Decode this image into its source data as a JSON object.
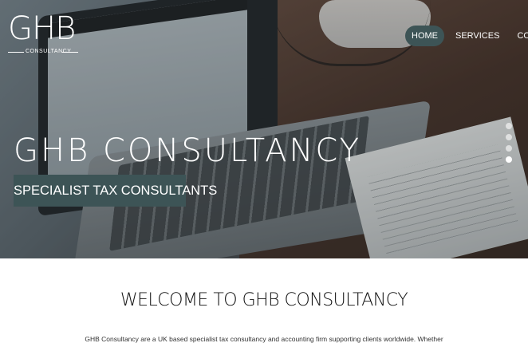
{
  "brand": {
    "logo_text": "GHB",
    "logo_sub": "CONSULTANCY"
  },
  "nav": {
    "items": [
      {
        "label": "HOME",
        "active": true
      },
      {
        "label": "SERVICES",
        "active": false
      },
      {
        "label": "CONTACT",
        "active": false
      }
    ]
  },
  "hero": {
    "title": "GHB CONSULTANCY",
    "tagline": "SPECIALIST TAX CONSULTANTS",
    "slides": 4,
    "active_slide": 4
  },
  "main": {
    "heading": "WELCOME TO GHB CONSULTANCY",
    "intro": "GHB Consultancy are a UK based specialist tax consultancy and accounting firm supporting clients worldwide. Whether"
  },
  "colors": {
    "accent": "#3d5456",
    "text_dark": "#111111"
  }
}
